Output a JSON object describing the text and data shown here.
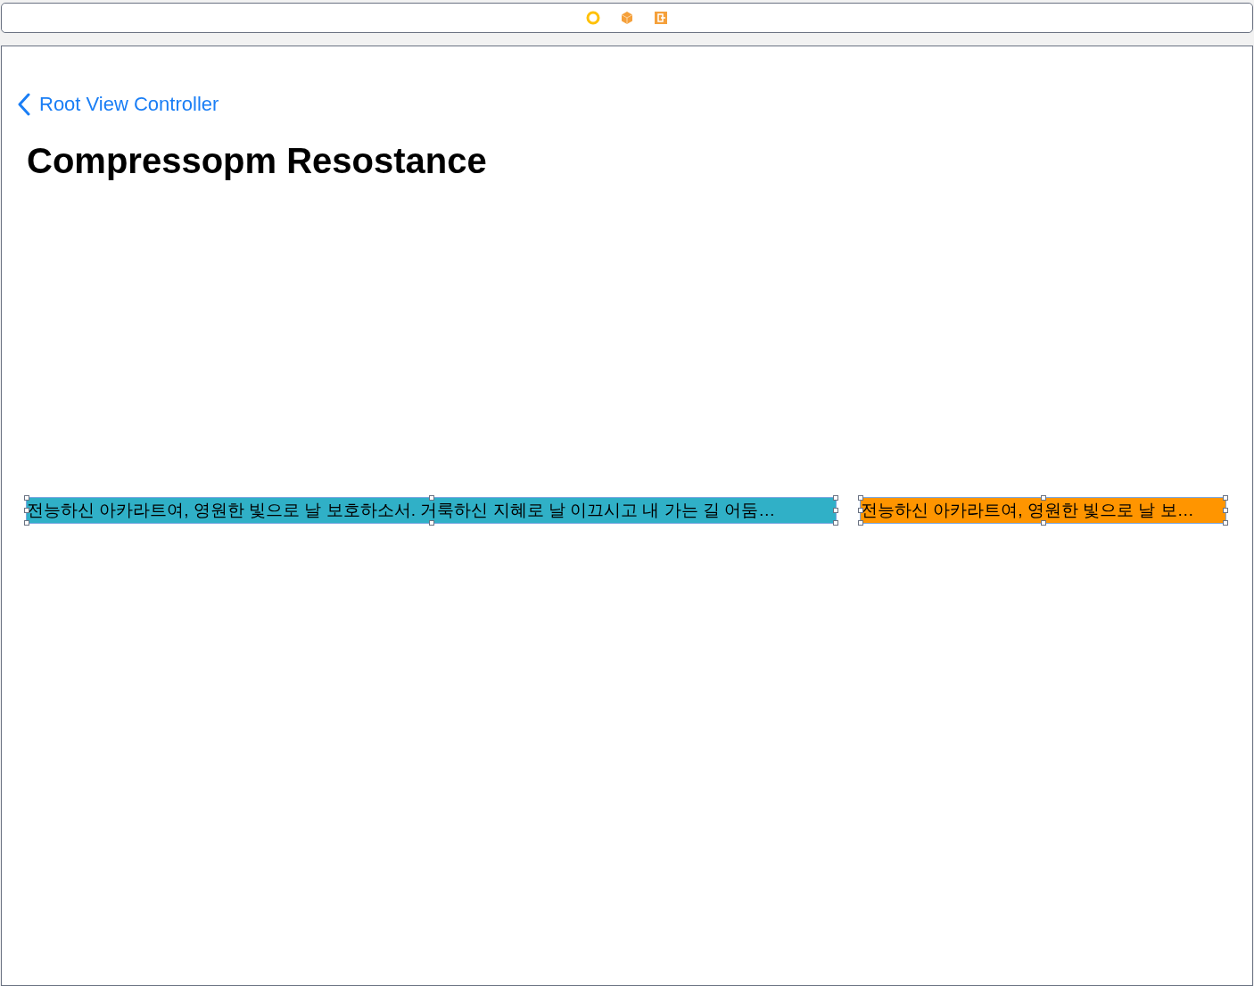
{
  "nav": {
    "back_label": "Root View Controller",
    "title": "Compressopm Resostance"
  },
  "labels": [
    {
      "text": "전능하신 아카라트여, 영원한 빛으로 날 보호하소서. 거룩하신 지혜로 날 이끄시고 내 가는 길 어둠…",
      "color": "#30b0c7",
      "selected": true
    },
    {
      "text": "전능하신 아카라트여, 영원한 빛으로 날 보…",
      "color": "#ff9500",
      "selected": true
    }
  ]
}
